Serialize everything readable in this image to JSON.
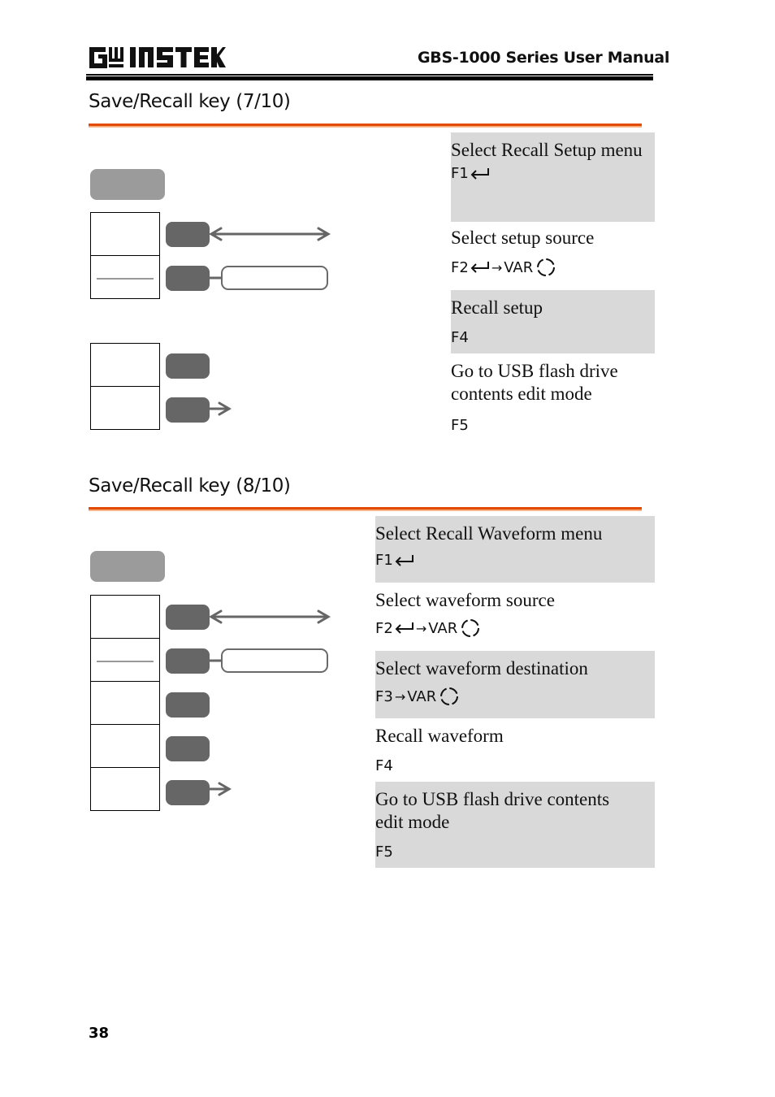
{
  "header": {
    "brand": "GW INSTEK",
    "manual_title": "GBS-1000 Series User Manual"
  },
  "sections": [
    {
      "title": "Save/Recall key (7/10)",
      "steps": [
        {
          "description": "Select Recall Setup menu",
          "key": "F1",
          "key_icons": [
            "return-icon"
          ],
          "shaded": true
        },
        {
          "description": "Select setup source",
          "key": "F2",
          "key_icons": [
            "return-icon",
            "arrow",
            "VAR",
            "knob-icon"
          ],
          "shaded": false
        },
        {
          "description": "Recall setup",
          "key": "F4",
          "key_icons": [],
          "shaded": true
        },
        {
          "description": "Go to USB flash drive contents edit mode",
          "key": "F5",
          "key_icons": [],
          "shaded": false
        }
      ]
    },
    {
      "title": "Save/Recall key (8/10)",
      "steps": [
        {
          "description": "Select Recall Waveform menu",
          "key": "F1",
          "key_icons": [
            "return-icon"
          ],
          "shaded": true
        },
        {
          "description": "Select waveform source",
          "key": "F2",
          "key_icons": [
            "return-icon",
            "arrow",
            "VAR",
            "knob-icon"
          ],
          "shaded": false
        },
        {
          "description": "Select waveform destination",
          "key": "F3",
          "key_icons": [
            "arrow",
            "VAR",
            "knob-icon"
          ],
          "shaded": true
        },
        {
          "description": "Recall waveform",
          "key": "F4",
          "key_icons": [],
          "shaded": false
        },
        {
          "description": "Go to USB flash drive contents edit mode",
          "key": "F5",
          "key_icons": [],
          "shaded": true
        }
      ]
    }
  ],
  "labels": {
    "arrow": "→",
    "var": "VAR"
  },
  "footer": {
    "page_number": "38"
  },
  "colors": {
    "accent_orange": "#e24a06",
    "shade_gray": "#d9d9d9",
    "key_gray": "#666666",
    "menu_gray": "#9b9b9b"
  }
}
